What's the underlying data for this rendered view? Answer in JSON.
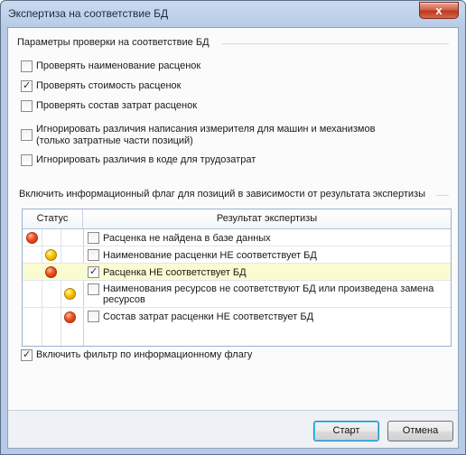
{
  "window": {
    "title": "Экспертиза на соответствие БД",
    "close_glyph": "x"
  },
  "params_group": {
    "title": "Параметры проверки на соответствие БД",
    "options": [
      {
        "label": "Проверять наименование расценок",
        "checked": false
      },
      {
        "label": "Проверять стоимость расценок",
        "checked": true
      },
      {
        "label": "Проверять состав затрат расценок",
        "checked": false
      },
      {
        "label": "Игнорировать различия написания измерителя для машин и механизмов",
        "label2": "(только затратные части позиций)",
        "checked": false
      },
      {
        "label": "Игнорировать различия в коде для трудозатрат",
        "checked": false
      }
    ]
  },
  "flags_group": {
    "title": "Включить информационный флаг для позиций в зависимости от результата экспертизы",
    "table": {
      "headers": {
        "status": "Статус",
        "result": "Результат экспертизы"
      },
      "rows": [
        {
          "status_color": "red",
          "status_column": 1,
          "checked": false,
          "text": "Расценка не найдена в базе данных",
          "text2": "",
          "highlight": false
        },
        {
          "status_color": "yellow",
          "status_column": 2,
          "checked": false,
          "text": "Наименование расценки НЕ соответствует БД",
          "text2": "",
          "highlight": false
        },
        {
          "status_color": "red",
          "status_column": 2,
          "checked": true,
          "text": "Расценка НЕ соответствует БД",
          "text2": "",
          "highlight": true
        },
        {
          "status_color": "yellow",
          "status_column": 3,
          "checked": false,
          "text": "Наименования ресурсов не соответствуют БД или произведена замена",
          "text2": "ресурсов",
          "highlight": false
        },
        {
          "status_color": "red",
          "status_column": 3,
          "checked": false,
          "text": "Состав затрат расценки НЕ соответствует БД",
          "text2": "",
          "highlight": false
        }
      ]
    }
  },
  "filter_option": {
    "label": "Включить фильтр по информационному флагу",
    "checked": true
  },
  "buttons": {
    "ok": "Старт",
    "cancel": "Отмена"
  },
  "colors": {
    "red": "#f04e1d",
    "yellow": "#f5c400",
    "highlight": "#fbfbd2"
  }
}
